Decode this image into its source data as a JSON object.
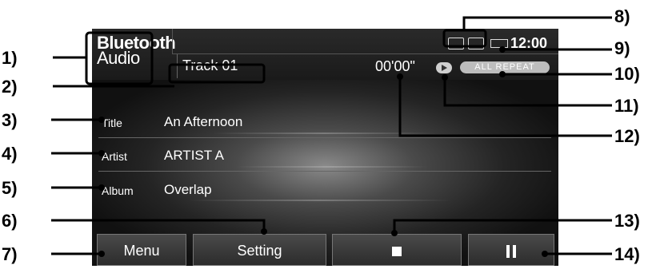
{
  "source": {
    "title_line1": "Bluetooth",
    "title_line2": "Audio"
  },
  "header": {
    "track": "Track 01",
    "elapsed_time": "00'00\"",
    "repeat_mode": "ALL REPEAT",
    "clock": "12:00"
  },
  "info": {
    "title_label": "Title",
    "title_value": "An Afternoon",
    "artist_label": "Artist",
    "artist_value": "ARTIST A",
    "album_label": "Album",
    "album_value": "Overlap"
  },
  "buttons": {
    "menu": "Menu",
    "setting": "Setting"
  },
  "callouts": [
    "1)",
    "2)",
    "3)",
    "4)",
    "5)",
    "6)",
    "7)",
    "8)",
    "9)",
    "10)",
    "11)",
    "12)",
    "13)",
    "14)"
  ],
  "colors": {
    "screen_bg": "#1a1a1a",
    "repeat_badge": "#bdbdbd",
    "leader_line": "#000000"
  },
  "icons": [
    "bluetooth-phone-icon",
    "bluetooth-audio-icon",
    "battery-icon",
    "play-indicator-icon",
    "stop-icon",
    "pause-icon"
  ]
}
